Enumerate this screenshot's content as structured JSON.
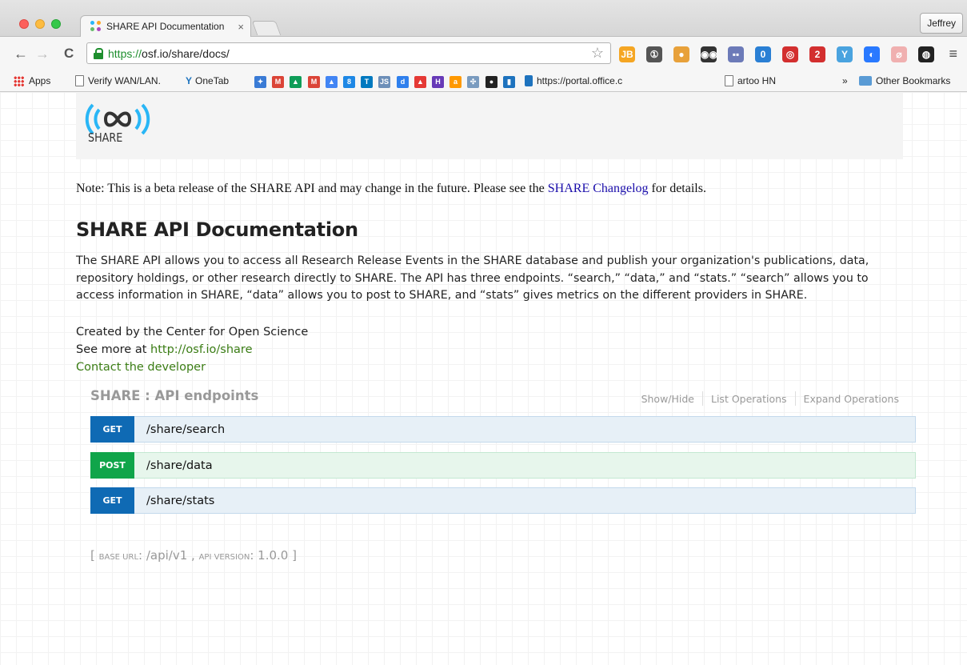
{
  "browser": {
    "tab_title": "SHARE API Documentation",
    "tab_close": "×",
    "profile_name": "Jeffrey",
    "url_scheme": "https://",
    "url_rest": "osf.io/share/docs/",
    "nav": {
      "back": "←",
      "forward": "→",
      "reload": "C"
    },
    "star": "☆",
    "menu": "≡",
    "extensions": [
      {
        "label": "JB",
        "color": "#f5a623"
      },
      {
        "label": "①",
        "color": "#555555"
      },
      {
        "label": "●",
        "color": "#e8a13a"
      },
      {
        "label": "◉◉",
        "color": "#333333"
      },
      {
        "label": "▪▪",
        "color": "#6c7ab8"
      },
      {
        "label": "0",
        "color": "#2a7fd4"
      },
      {
        "label": "◎",
        "color": "#d32f2f"
      },
      {
        "label": "2",
        "color": "#d32f2f"
      },
      {
        "label": "Y",
        "color": "#4aa3df"
      },
      {
        "label": "◐",
        "color": "#2979ff"
      },
      {
        "label": "⌀",
        "color": "#f0b0b0"
      },
      {
        "label": "◍",
        "color": "#222222"
      }
    ]
  },
  "bookmarks": {
    "apps": "Apps",
    "verify": "Verify WAN/LAN.",
    "onetab": "OneTab",
    "tiles": [
      {
        "label": "✦",
        "color": "#3a7bd5"
      },
      {
        "label": "M",
        "color": "#db4437"
      },
      {
        "label": "▲",
        "color": "#0f9d58"
      },
      {
        "label": "M",
        "color": "#db4437"
      },
      {
        "label": "▲",
        "color": "#4285f4"
      },
      {
        "label": "8",
        "color": "#1e88e5"
      },
      {
        "label": "T",
        "color": "#0079bf"
      },
      {
        "label": "JS",
        "color": "#6d8fb8"
      },
      {
        "label": "d",
        "color": "#2f80ed"
      },
      {
        "label": "▲",
        "color": "#e53935"
      },
      {
        "label": "H",
        "color": "#673ab7"
      },
      {
        "label": "a",
        "color": "#ff9900"
      },
      {
        "label": "✣",
        "color": "#7a9bbf"
      },
      {
        "label": "●",
        "color": "#222222"
      },
      {
        "label": "▮",
        "color": "#1e73be"
      }
    ],
    "portal": "https://portal.office.c",
    "artoo": "artoo HN",
    "overflow": "»",
    "other": "Other Bookmarks"
  },
  "page": {
    "logo_text": "SHARE",
    "note_prefix": "Note: This is a beta release of the SHARE API and may change in the future. Please see the ",
    "note_link": "SHARE Changelog",
    "note_suffix": " for details.",
    "title": "SHARE API Documentation",
    "description": "The SHARE API allows you to access all Research Release Events in the SHARE database and publish your organization's publications, data, repository holdings, or other research directly to SHARE. The API has three endpoints. “search,” “data,” and “stats.” “search” allows you to access information in SHARE, “data” allows you to post to SHARE, and “stats” gives metrics on the different providers in SHARE.",
    "created_by": "Created by the Center for Open Science",
    "see_more_prefix": "See more at ",
    "see_more_link": "http://osf.io/share",
    "contact": "Contact the developer"
  },
  "endpoints": {
    "title": "SHARE : API endpoints",
    "show_hide": "Show/Hide",
    "list_ops": "List Operations",
    "expand_ops": "Expand Operations",
    "ops": [
      {
        "method": "GET",
        "path": "/share/search"
      },
      {
        "method": "POST",
        "path": "/share/data"
      },
      {
        "method": "GET",
        "path": "/share/stats"
      }
    ]
  },
  "footer": {
    "open": "[ ",
    "base_url_label": "Base URL",
    "base_url": "/api/v1",
    "sep": " , ",
    "api_version_label": "API Version",
    "api_version": "1.0.0",
    "close": " ]"
  }
}
